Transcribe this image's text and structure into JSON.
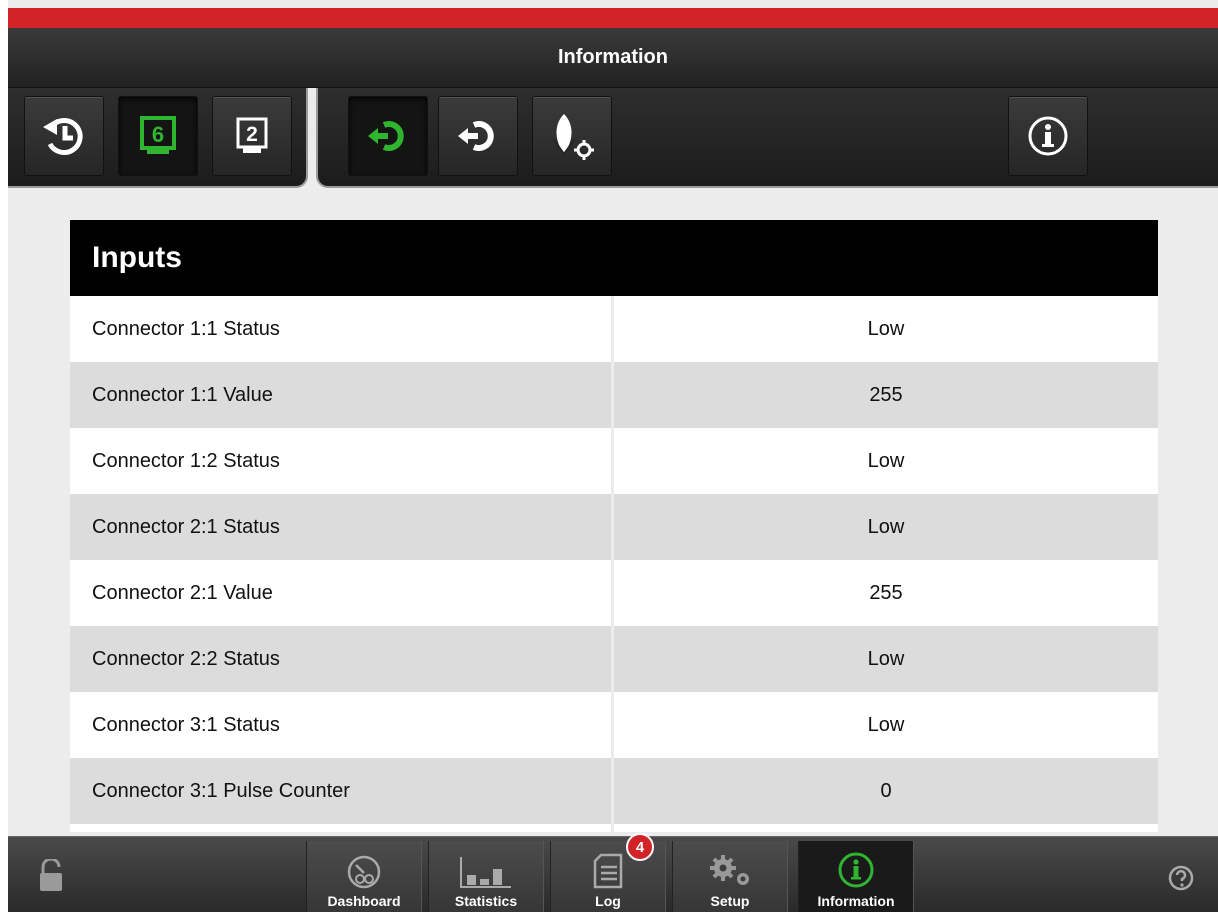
{
  "titlebar": {
    "title": "Information"
  },
  "toolbar": {
    "left_buttons": [
      {
        "icon": "history-icon"
      },
      {
        "icon": "display-6-icon",
        "label": "6",
        "active": true
      },
      {
        "icon": "display-2-icon",
        "label": "2"
      }
    ],
    "right_buttons": [
      {
        "icon": "inputs-icon",
        "active": true
      },
      {
        "icon": "outputs-icon"
      },
      {
        "icon": "crop-settings-icon"
      },
      {
        "icon": "info-icon"
      }
    ]
  },
  "panel": {
    "title": "Inputs",
    "rows": [
      {
        "label": "Connector 1:1 Status",
        "value": "Low"
      },
      {
        "label": "Connector 1:1 Value",
        "value": "255"
      },
      {
        "label": "Connector 1:2 Status",
        "value": "Low"
      },
      {
        "label": "Connector 2:1 Status",
        "value": "Low"
      },
      {
        "label": "Connector 2:1 Value",
        "value": "255"
      },
      {
        "label": "Connector 2:2 Status",
        "value": "Low"
      },
      {
        "label": "Connector 3:1 Status",
        "value": "Low"
      },
      {
        "label": "Connector 3:1 Pulse Counter",
        "value": "0"
      },
      {
        "label": "",
        "value": ""
      }
    ]
  },
  "bottom_nav": {
    "items": [
      {
        "label": "Dashboard",
        "icon": "dashboard-icon"
      },
      {
        "label": "Statistics",
        "icon": "statistics-icon"
      },
      {
        "label": "Log",
        "icon": "log-icon",
        "badge": "4"
      },
      {
        "label": "Setup",
        "icon": "setup-gears-icon"
      },
      {
        "label": "Information",
        "icon": "info-icon",
        "active": true
      }
    ]
  },
  "colors": {
    "accent_red": "#d22329",
    "active_green": "#2fb52f",
    "header_black": "#000000"
  }
}
